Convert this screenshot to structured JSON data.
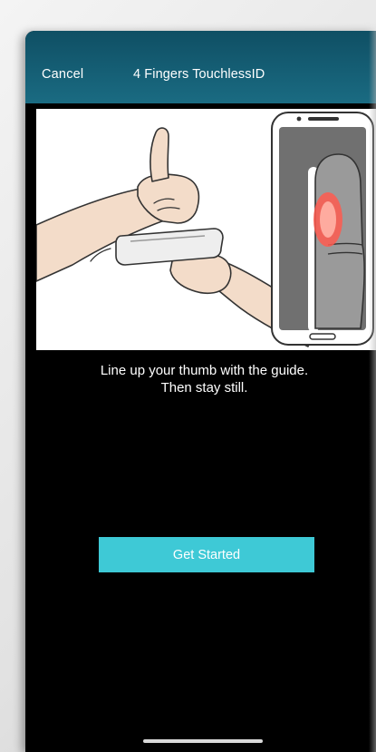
{
  "navbar": {
    "cancel_label": "Cancel",
    "title": "4 Fingers TouchlessID"
  },
  "illustration": {
    "icon": "thumb-scan-illustration"
  },
  "instructions": {
    "line1": "Line up your thumb with the guide.",
    "line2": "Then stay still."
  },
  "actions": {
    "get_started_label": "Get Started"
  },
  "colors": {
    "navbar": "#1a6b82",
    "accent": "#3ec9d6",
    "background": "#000000"
  }
}
